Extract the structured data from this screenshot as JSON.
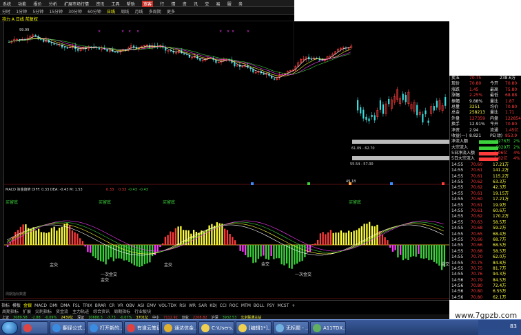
{
  "menubar": {
    "items": [
      "系统",
      "功能",
      "报价",
      "分析",
      "扩展市场行情",
      "资讯",
      "工具",
      "帮助"
    ],
    "active_label": "宽客",
    "right_items": [
      "行",
      "情",
      "资",
      "讯",
      "交",
      "易",
      "服",
      "务"
    ]
  },
  "toolbar": {
    "items": [
      "分时",
      "1分钟",
      "5分钟",
      "15分钟",
      "30分钟",
      "60分钟",
      "日线",
      "周线",
      "月线",
      "多周期",
      "更多"
    ]
  },
  "chart": {
    "title": "持力 A 日线 前复权",
    "high_label": "99.99",
    "price_range_label1": "61.09 - 62.70",
    "price_range_label2": "55.54 - 57.00",
    "low_label": "49.18",
    "macd_header": "MACD 资金趋势 DIFF: 0.33 DEA: -0.43 M: 1.53",
    "macd_labels": {
      "jin_cha_1": "金交",
      "jin_cha_2": "金交",
      "jin_cha_3": "金交",
      "jin_cha_4": "金交",
      "jin_cha_5": "金交",
      "ci_jin_cha_1": "一次金交",
      "ci_jin_cha_2": "一次金交",
      "buy_1": "买留底",
      "buy_2": "买留底",
      "buy_3": "买留底",
      "buy_4": "买留底"
    },
    "watermark_small": "周期指标数据",
    "ind_values": [
      "0.33",
      "0.33",
      "-0.43",
      "-0.43"
    ]
  },
  "quote": {
    "rows": [
      {
        "l": "卖五",
        "v": "70.75",
        "c": "red",
        "r": "238.6万"
      },
      {
        "l": "现价",
        "v": "70.80",
        "c": "red",
        "r2l": "今开",
        "r2": "70.80"
      },
      {
        "l": "涨跌",
        "v": "1.45",
        "c": "red",
        "r2l": "最高",
        "r2": "75.80"
      },
      {
        "l": "涨幅",
        "v": "2.25%",
        "c": "red",
        "r2l": "最低",
        "r2": "68.88"
      },
      {
        "l": "振幅",
        "v": "9.88%",
        "c": "white",
        "r2l": "量比",
        "r2": "1.87"
      },
      {
        "l": "总量",
        "v": "3251",
        "c": "yellow",
        "r2l": "均价",
        "r2": "70.80"
      },
      {
        "l": "总金",
        "v": "258213",
        "c": "yellow",
        "r2l": "量比",
        "r2": "1.71"
      },
      {
        "l": "外盘",
        "v": "127359",
        "c": "red",
        "r2l": "内盘",
        "r2": "122854"
      },
      {
        "l": "换手",
        "v": "12.91%",
        "c": "white",
        "r2l": "今开",
        "r2": "70.80"
      },
      {
        "l": "净资",
        "v": "2.94",
        "c": "white",
        "r2l": "流通",
        "r2": "1.45亿"
      },
      {
        "l": "收益(一)",
        "v": "8.821",
        "c": "white",
        "r2l": "PE(动)",
        "r2": "853.9"
      }
    ],
    "flow_rows": [
      {
        "l": "净流入额",
        "v": "-3276万",
        "p": "2%"
      },
      {
        "l": "大宗流入",
        "v": "-6029万",
        "p": "2%"
      },
      {
        "l": "5日净流入额",
        "v": "2.06亿",
        "p": "4%"
      },
      {
        "l": "5日大宗流入",
        "v": "1.82亿",
        "p": "4%"
      }
    ],
    "ticks": [
      {
        "t": "14:55",
        "p": "70.60",
        "v": "17.21万"
      },
      {
        "t": "14:55",
        "p": "70.61",
        "v": "141.2万"
      },
      {
        "t": "14:55",
        "p": "70.61",
        "v": "115.2万"
      },
      {
        "t": "14:55",
        "p": "70.62",
        "v": "63.3万"
      },
      {
        "t": "14:55",
        "p": "70.62",
        "v": "42.3万"
      },
      {
        "t": "14:55",
        "p": "70.61",
        "v": "19.15万"
      },
      {
        "t": "14:55",
        "p": "70.60",
        "v": "17.21万"
      },
      {
        "t": "14:55",
        "p": "70.61",
        "v": "19.9万"
      },
      {
        "t": "14:55",
        "p": "70.61",
        "v": "60.6万"
      },
      {
        "t": "14:55",
        "p": "70.62",
        "v": "170.2万"
      },
      {
        "t": "14:55",
        "p": "70.63",
        "v": "58.5万"
      },
      {
        "t": "14:55",
        "p": "70.68",
        "v": "59.2万"
      },
      {
        "t": "14:55",
        "p": "70.65",
        "v": "68.4万"
      },
      {
        "t": "14:55",
        "p": "70.66",
        "v": "68.7万"
      },
      {
        "t": "14:55",
        "p": "70.66",
        "v": "68.5万"
      },
      {
        "t": "14:55",
        "p": "70.68",
        "v": "58.5万"
      },
      {
        "t": "14:55",
        "p": "70.70",
        "v": "62.0万"
      },
      {
        "t": "14:55",
        "p": "70.75",
        "v": "84.8万"
      },
      {
        "t": "14:55",
        "p": "70.75",
        "v": "81.7万"
      },
      {
        "t": "14:55",
        "p": "70.76",
        "v": "94.3万"
      },
      {
        "t": "14:56",
        "p": "70.79",
        "v": "84.5万"
      },
      {
        "t": "14:56",
        "p": "70.80",
        "v": "72.4万"
      },
      {
        "t": "14:56",
        "p": "70.80",
        "v": "6.55万"
      },
      {
        "t": "14:56",
        "p": "70.80",
        "v": "62.1万"
      },
      {
        "t": "14:56",
        "p": "70.80",
        "v": "45.3万"
      },
      {
        "t": "14:56",
        "p": "70.80",
        "v": "99.8万"
      }
    ],
    "bottom_label": "日线"
  },
  "bottombar": {
    "items": [
      "指标",
      "模板",
      "金银",
      "MACD",
      "DMI",
      "DMA",
      "FSL",
      "TRIX",
      "BRAR",
      "CR",
      "VR",
      "OBV",
      "ASI",
      "EMV",
      "VOL-TDX",
      "RSI",
      "WR",
      "SAR",
      "KDJ",
      "CCI",
      "ROC",
      "MTM",
      "BOLL",
      "PSY",
      "MCST",
      "+"
    ],
    "second": [
      "能量潮指标",
      "准确买卖",
      "精准买卖",
      "牛熊资金趋势",
      "解盘",
      "判背",
      "异动分析",
      "异动信号",
      "精准买卖主图",
      "增仓加仓",
      "资金动向",
      "资金迹线",
      "一天之资金",
      "主力持仓",
      "主力加仓",
      "资金追踪",
      "资金流向",
      "成交量平台",
      "集群资金流",
      "五指标共振",
      "DMI三彩线",
      "DMI副图",
      "DMI-X",
      "CDP",
      "CDP分时"
    ],
    "third": [
      "周期指标",
      "扩展",
      "尖刺指标",
      "资金流",
      "主力轨迹",
      "综合资讯",
      "周期指标",
      "行业板块"
    ]
  },
  "statusbar": {
    "items": [
      {
        "text": "上证",
        "c": "white"
      },
      {
        "text": "3089.58",
        "c": "green"
      },
      {
        "text": "-2.88",
        "c": "green"
      },
      {
        "text": "-0.09%",
        "c": "green"
      },
      {
        "text": "2439亿",
        "c": "yellow"
      },
      {
        "text": "深证",
        "c": "white"
      },
      {
        "text": "10688.3",
        "c": "green"
      },
      {
        "text": "-7.73",
        "c": "green"
      },
      {
        "text": "-0.07%",
        "c": "green"
      },
      {
        "text": "3701亿",
        "c": "yellow"
      },
      {
        "text": "中小",
        "c": "white"
      },
      {
        "text": "7112.92",
        "c": "red"
      },
      {
        "text": "创业",
        "c": "white"
      },
      {
        "text": "2208.82",
        "c": "red"
      },
      {
        "text": "沪深",
        "c": "white"
      },
      {
        "text": "3932.53",
        "c": "green"
      },
      {
        "text": "北京联通主站",
        "c": "yellow"
      }
    ]
  },
  "taskbar": {
    "tasks": [
      {
        "label": "",
        "color": "#dd4444"
      },
      {
        "label": "翻译公式...",
        "color": "#3b8be0"
      },
      {
        "label": "打开新的...",
        "color": "#3b8be0"
      },
      {
        "label": "有道云笔记",
        "color": "#e04040"
      },
      {
        "label": "通达信金...",
        "color": "#e0b030"
      },
      {
        "label": "C:\\Users...",
        "color": "#f0d050"
      },
      {
        "label": "[编辑1*]...",
        "color": "#f0d050"
      },
      {
        "label": "无标题 - ...",
        "color": "#70b0e0"
      },
      {
        "label": "A11TDX...",
        "color": "#60b060"
      }
    ],
    "tray_time": "83"
  },
  "watermark": "www.7gpzb.com",
  "side_brand": "S英"
}
